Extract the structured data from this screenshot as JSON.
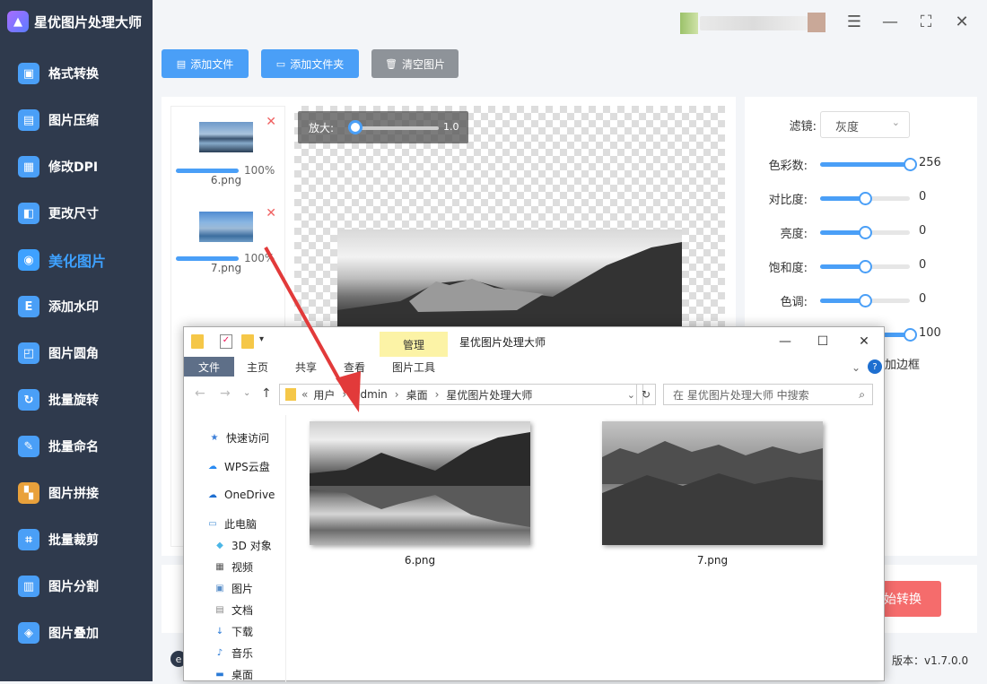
{
  "app": {
    "title": "星优图片处理大师",
    "logo_glyph": "▲",
    "version": "版本：v1.7.0.0"
  },
  "sidebar": {
    "items": [
      {
        "label": "格式转换",
        "icon": "format-icon",
        "color": "#4a9ff7"
      },
      {
        "label": "图片压缩",
        "icon": "compress-icon",
        "color": "#4a9ff7"
      },
      {
        "label": "修改DPI",
        "icon": "dpi-icon",
        "color": "#4a9ff7"
      },
      {
        "label": "更改尺寸",
        "icon": "resize-icon",
        "color": "#4a9ff7"
      },
      {
        "label": "美化图片",
        "icon": "beautify-icon",
        "color": "#3ea1ff",
        "active": true
      },
      {
        "label": "添加水印",
        "icon": "watermark-icon",
        "color": "#4a9ff7"
      },
      {
        "label": "图片圆角",
        "icon": "rounded-corner-icon",
        "color": "#4a9ff7"
      },
      {
        "label": "批量旋转",
        "icon": "rotate-icon",
        "color": "#4a9ff7"
      },
      {
        "label": "批量命名",
        "icon": "rename-icon",
        "color": "#4a9ff7"
      },
      {
        "label": "图片拼接",
        "icon": "splice-icon",
        "color": "#e9a13b"
      },
      {
        "label": "批量裁剪",
        "icon": "crop-icon",
        "color": "#4a9ff7"
      },
      {
        "label": "图片分割",
        "icon": "split-icon",
        "color": "#4a9ff7"
      },
      {
        "label": "图片叠加",
        "icon": "overlay-icon",
        "color": "#4a9ff7"
      }
    ]
  },
  "toolbar": {
    "add_file": "添加文件",
    "add_folder": "添加文件夹",
    "clear": "清空图片"
  },
  "files": [
    {
      "name": "6.png",
      "progress": "100%"
    },
    {
      "name": "7.png",
      "progress": "100%"
    }
  ],
  "zoom": {
    "label": "放大:",
    "value": "1.0"
  },
  "settings": {
    "filter": {
      "label": "滤镜:",
      "value": "灰度"
    },
    "sliders": [
      {
        "label": "色彩数:",
        "value": "256",
        "fraction": 1.0
      },
      {
        "label": "对比度:",
        "value": "0",
        "fraction": 0.5
      },
      {
        "label": "亮度:",
        "value": "0",
        "fraction": 0.5
      },
      {
        "label": "饱和度:",
        "value": "0",
        "fraction": 0.5
      },
      {
        "label": "色调:",
        "value": "0",
        "fraction": 0.5
      },
      {
        "label": "",
        "value": "100",
        "fraction": 1.0
      }
    ],
    "border_label": "加边框"
  },
  "start_button": "开始转换",
  "explorer": {
    "title": "星优图片处理大师",
    "manage_tab": "管理",
    "image_tools_tab": "图片工具",
    "tabs": [
      "文件",
      "主页",
      "共享",
      "查看"
    ],
    "address": [
      "用户",
      "admin",
      "桌面",
      "星优图片处理大师"
    ],
    "search_placeholder": "在 星优图片处理大师 中搜索",
    "nav": [
      {
        "label": "快速访问",
        "icon": "star-icon"
      },
      {
        "label": "WPS云盘",
        "icon": "cloud-icon"
      },
      {
        "label": "OneDrive",
        "icon": "onedrive-icon"
      },
      {
        "label": "此电脑",
        "icon": "computer-icon"
      },
      {
        "label": "3D 对象",
        "icon": "3d-object-icon"
      },
      {
        "label": "视频",
        "icon": "video-icon"
      },
      {
        "label": "图片",
        "icon": "picture-icon"
      },
      {
        "label": "文档",
        "icon": "document-icon"
      },
      {
        "label": "下载",
        "icon": "download-icon"
      },
      {
        "label": "音乐",
        "icon": "music-icon"
      },
      {
        "label": "桌面",
        "icon": "desktop-icon"
      }
    ],
    "files": [
      "6.png",
      "7.png"
    ]
  }
}
